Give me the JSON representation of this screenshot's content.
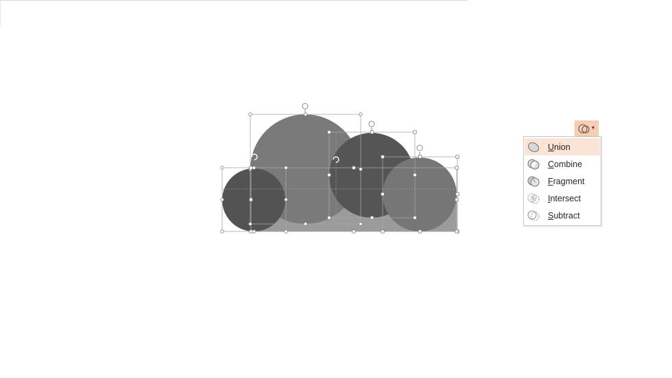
{
  "ribbon": {
    "merge_button": {
      "icon": "merge-shapes-icon",
      "arrow": "▾"
    }
  },
  "merge_menu": {
    "items": [
      {
        "id": "union",
        "accel": "U",
        "rest": "nion",
        "icon": "union-icon",
        "hovered": true
      },
      {
        "id": "combine",
        "accel": "C",
        "rest": "ombine",
        "icon": "combine-icon",
        "hovered": false
      },
      {
        "id": "fragment",
        "accel": "F",
        "rest": "ragment",
        "icon": "fragment-icon",
        "hovered": false
      },
      {
        "id": "intersect",
        "accel": "I",
        "rest": "ntersect",
        "icon": "intersect-icon",
        "hovered": false
      },
      {
        "id": "subtract",
        "accel": "S",
        "rest": "ubtract",
        "icon": "subtract-icon",
        "hovered": false
      }
    ]
  },
  "slide": {
    "shape_colors": {
      "base_rect": "#9b9b9b",
      "large_circle": "#7a7a7a",
      "left_circle": "#535353",
      "dark_circle": "#555555",
      "right_circle": "#767676",
      "menu_hover": "#fbe3d6",
      "button_pressed": "#f9cdb3"
    }
  }
}
